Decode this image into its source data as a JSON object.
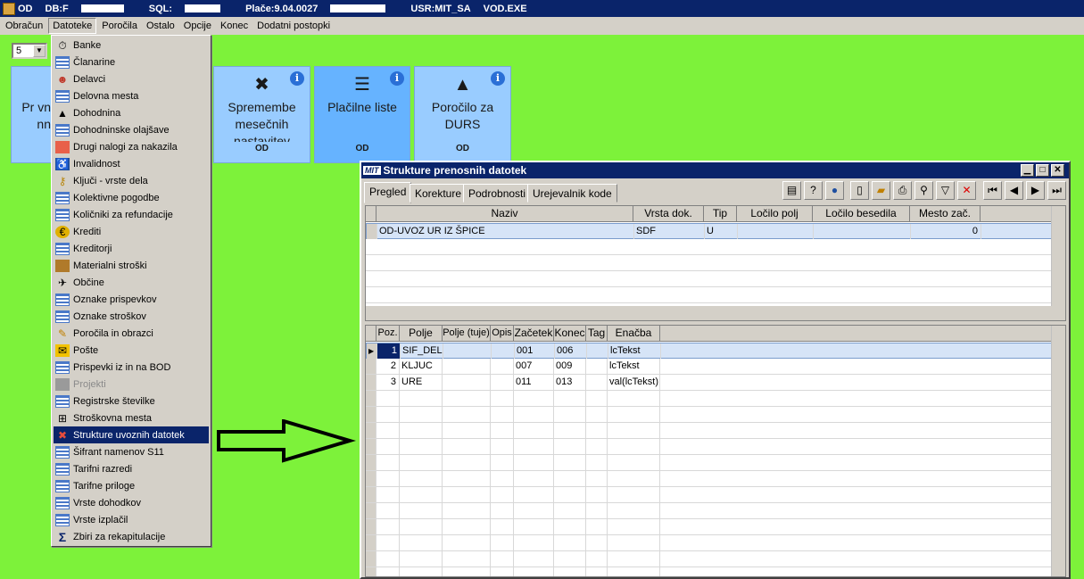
{
  "titlebar": {
    "app": "OD",
    "db_label": "DB:F",
    "sql_label": "SQL:",
    "place": "Plače:9.04.0027",
    "user": "USR:MIT_SA",
    "exe": "VOD.EXE"
  },
  "menubar": [
    "Obračun",
    "Datoteke",
    "Poročila",
    "Ostalo",
    "Opcije",
    "Konec",
    "Dodatni postopki"
  ],
  "combo": {
    "value": "5"
  },
  "tiles": [
    {
      "title": "Pr vn nn",
      "foot": ""
    },
    {
      "title": "Spremembe mesečnih nastavitev",
      "foot": "OD"
    },
    {
      "title": "Plačilne liste",
      "foot": "OD"
    },
    {
      "title": "Poročilo za DURS",
      "foot": "OD"
    }
  ],
  "dropdown": [
    {
      "label": "Banke",
      "icon": "clock-icon"
    },
    {
      "label": "Članarine",
      "icon": "list-icon"
    },
    {
      "label": "Delavci",
      "icon": "people-icon"
    },
    {
      "label": "Delovna mesta",
      "icon": "list-icon"
    },
    {
      "label": "Dohodnina",
      "icon": "durs-icon"
    },
    {
      "label": "Dohodninske olajšave",
      "icon": "list-icon"
    },
    {
      "label": "Drugi nalogi za nakazila",
      "icon": "payment-icon"
    },
    {
      "label": "Invalidnost",
      "icon": "wheelchair-icon"
    },
    {
      "label": "Ključi - vrste dela",
      "icon": "key-icon"
    },
    {
      "label": "Kolektivne pogodbe",
      "icon": "list-icon"
    },
    {
      "label": "Količniki za refundacije",
      "icon": "list-icon"
    },
    {
      "label": "Krediti",
      "icon": "euro-icon"
    },
    {
      "label": "Kreditorji",
      "icon": "list-icon"
    },
    {
      "label": "Materialni stroški",
      "icon": "box-icon"
    },
    {
      "label": "Občine",
      "icon": "map-icon"
    },
    {
      "label": "Oznake prispevkov",
      "icon": "list-icon"
    },
    {
      "label": "Oznake stroškov",
      "icon": "list-icon"
    },
    {
      "label": "Poročila in obrazci",
      "icon": "report-icon"
    },
    {
      "label": "Pošte",
      "icon": "post-icon"
    },
    {
      "label": "Prispevki iz in na BOD",
      "icon": "list-icon"
    },
    {
      "label": "Projekti",
      "icon": "project-icon",
      "disabled": true
    },
    {
      "label": "Registrske številke",
      "icon": "list-icon"
    },
    {
      "label": "Stroškovna mesta",
      "icon": "tree-icon"
    },
    {
      "label": "Strukture uvoznih datotek",
      "icon": "structure-icon",
      "selected": true
    },
    {
      "label": "Šifrant namenov S11",
      "icon": "list-icon"
    },
    {
      "label": "Tarifni razredi",
      "icon": "list-icon"
    },
    {
      "label": "Tarifne priloge",
      "icon": "list-icon"
    },
    {
      "label": "Vrste dohodkov",
      "icon": "list-icon"
    },
    {
      "label": "Vrste izplačil",
      "icon": "list-icon"
    },
    {
      "label": "Zbiri za rekapitulacije",
      "icon": "sigma-icon"
    }
  ],
  "child": {
    "logo": "MIT",
    "title": "Strukture prenosnih datotek",
    "tabs": [
      "Pregled",
      "Korekture",
      "Podrobnosti",
      "Urejevalnik kode"
    ],
    "top_grid": {
      "headers": [
        "Naziv",
        "Vrsta dok.",
        "Tip",
        "Ločilo polj",
        "Ločilo besedila",
        "Mesto zač."
      ],
      "rows": [
        [
          "OD-UVOZ UR IZ ŠPICE",
          "SDF",
          "U",
          "",
          "",
          "0"
        ]
      ]
    },
    "bottom_grid": {
      "headers": [
        "Poz.",
        "Polje",
        "Polje (tuje)",
        "Opis",
        "Začetek",
        "Konec",
        "Tag",
        "Enačba"
      ],
      "rows": [
        [
          "1",
          "SIF_DEL",
          "",
          "",
          "001",
          "006",
          "",
          "lcTekst"
        ],
        [
          "2",
          "KLJUC",
          "",
          "",
          "007",
          "009",
          "",
          "lcTekst"
        ],
        [
          "3",
          "URE",
          "",
          "",
          "011",
          "013",
          "",
          "val(lcTekst)"
        ]
      ]
    }
  },
  "colors": {
    "desktop": "#7df23a",
    "tile": "#99ccff",
    "tile_active": "#66b3ff",
    "titlebar": "#0a246a"
  }
}
